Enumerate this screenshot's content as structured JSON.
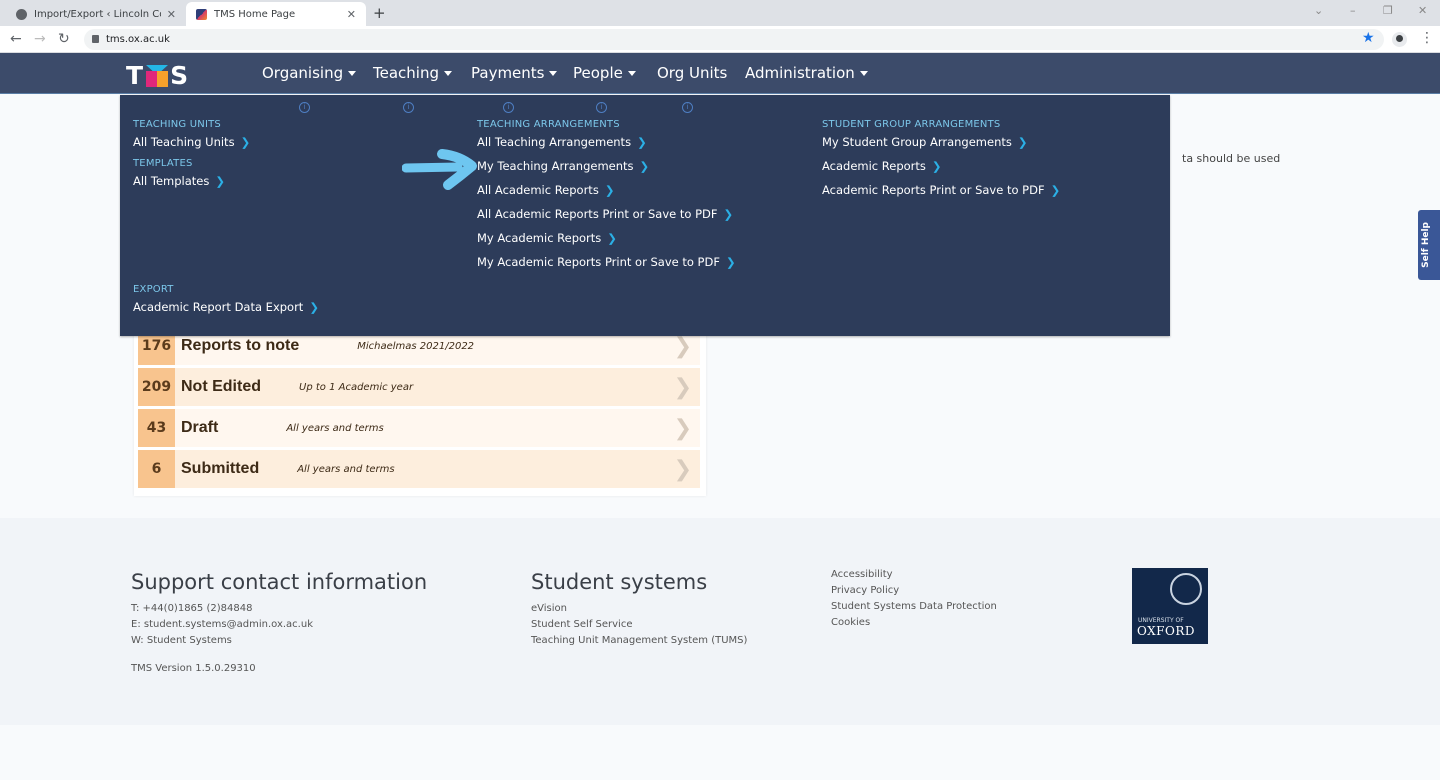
{
  "browser": {
    "tabs": [
      {
        "title": "Import/Export ‹ Lincoln College ‹",
        "active": false
      },
      {
        "title": "TMS Home Page",
        "active": true
      }
    ],
    "url": "tms.ox.ac.uk",
    "icons": {
      "back": "←",
      "forward": "→",
      "reload": "↻",
      "close": "✕",
      "new_tab": "+",
      "star": "★",
      "menu": "⋮",
      "minimize": "–",
      "restore": "❐",
      "window_close": "✕",
      "tab_search": "⌄"
    }
  },
  "app": {
    "logo_left": "T",
    "logo_right": "S",
    "nav": [
      {
        "label": "Organising",
        "dropdown": true
      },
      {
        "label": "Teaching",
        "dropdown": true
      },
      {
        "label": "Payments",
        "dropdown": true
      },
      {
        "label": "People",
        "dropdown": true
      },
      {
        "label": "Org Units",
        "dropdown": false
      },
      {
        "label": "Administration",
        "dropdown": true
      }
    ]
  },
  "dropdown": {
    "info_icon": "i",
    "chevron": "❯",
    "columns": {
      "teaching_units": {
        "heading": "TEACHING UNITS",
        "links": [
          "All Teaching Units"
        ]
      },
      "templates": {
        "heading": "TEMPLATES",
        "links": [
          "All Templates"
        ]
      },
      "export": {
        "heading": "EXPORT",
        "links": [
          "Academic Report Data Export"
        ]
      },
      "teaching_arrangements": {
        "heading": "TEACHING ARRANGEMENTS",
        "links": [
          "All Teaching Arrangements",
          "My Teaching Arrangements",
          "All Academic Reports",
          "All Academic Reports Print or Save to PDF",
          "My Academic Reports",
          "My Academic Reports Print or Save to PDF"
        ]
      },
      "student_group_arrangements": {
        "heading": "STUDENT GROUP ARRANGEMENTS",
        "links": [
          "My Student Group Arrangements",
          "Academic Reports",
          "Academic Reports Print or Save to PDF"
        ]
      }
    },
    "annotation_arrow_color": "#6ec6f0"
  },
  "page": {
    "intro_fragment": "ta should be used",
    "self_help": "Self Help",
    "reports": [
      {
        "count": "176",
        "label": "Reports to note",
        "note": "Michaelmas 2021/2022"
      },
      {
        "count": "209",
        "label": "Not Edited",
        "note": "Up to 1 Academic year"
      },
      {
        "count": "43",
        "label": "Draft",
        "note": "All years and terms"
      },
      {
        "count": "6",
        "label": "Submitted",
        "note": "All years and terms"
      }
    ],
    "report_chevron": "❯"
  },
  "footer": {
    "support": {
      "heading": "Support contact information",
      "phone": "T: +44(0)1865 (2)84848",
      "email": "E: student.systems@admin.ox.ac.uk",
      "web": "W: Student Systems",
      "version": "TMS Version 1.5.0.29310"
    },
    "systems": {
      "heading": "Student systems",
      "links": [
        "eVision",
        "Student Self Service",
        "Teaching Unit Management System (TUMS)"
      ]
    },
    "legal": [
      "Accessibility",
      "Privacy Policy",
      "Student Systems Data Protection",
      "Cookies"
    ],
    "oxford_logo": {
      "line1": "UNIVERSITY OF",
      "line2": "OXFORD"
    }
  },
  "colors": {
    "nav_bg": "#3c4b6a",
    "dropdown_bg": "#2d3c5a",
    "section_heading": "#7cc7ea",
    "link_chevron": "#2bb0e6",
    "report_count_bg": "#f8c48e"
  }
}
